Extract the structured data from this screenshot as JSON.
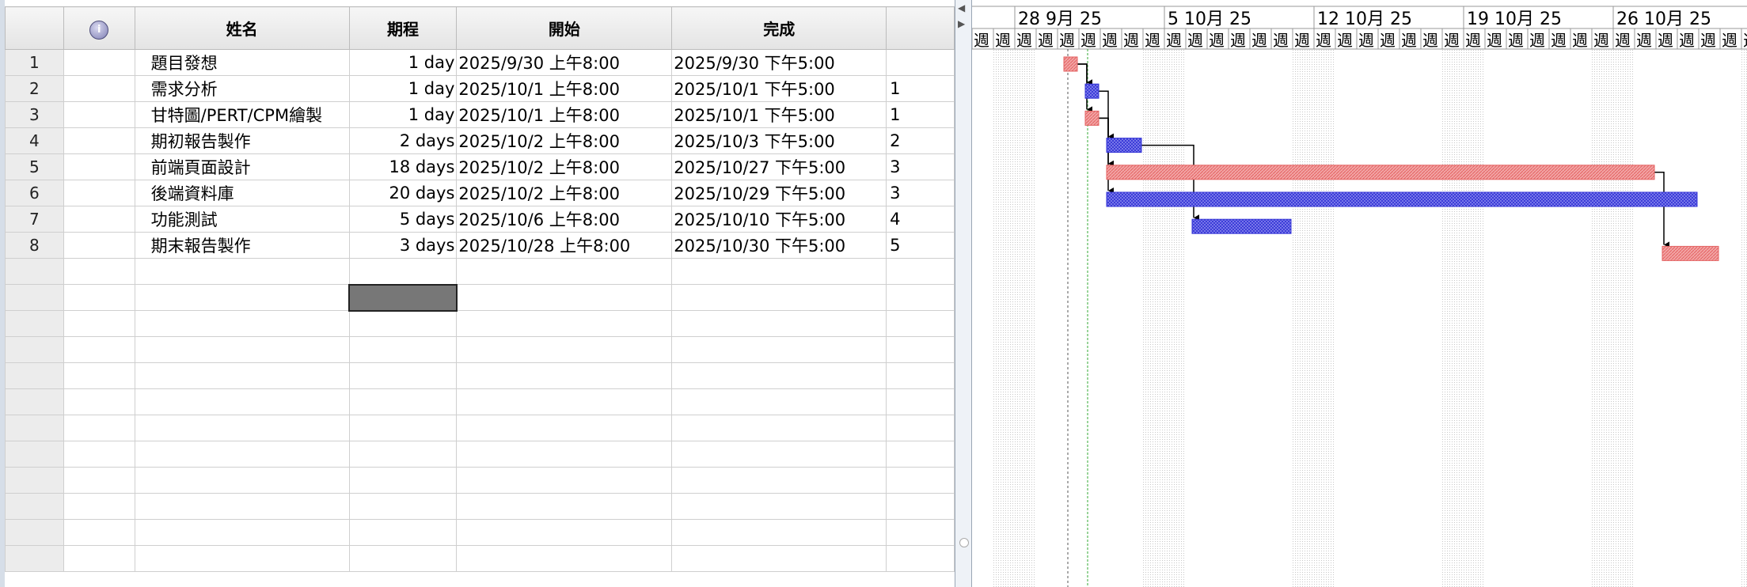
{
  "table": {
    "headers": {
      "indicator_icon": "information-icon",
      "name": "姓名",
      "duration": "期程",
      "start": "開始",
      "finish": "完成",
      "predecessors": ""
    },
    "rows": [
      {
        "id": "1",
        "name": "題目發想",
        "duration": "1 day",
        "start": "2025/9/30 上午8:00",
        "finish": "2025/9/30 下午5:00",
        "pred": ""
      },
      {
        "id": "2",
        "name": "需求分析",
        "duration": "1 day",
        "start": "2025/10/1 上午8:00",
        "finish": "2025/10/1 下午5:00",
        "pred": "1"
      },
      {
        "id": "3",
        "name": "甘特圖/PERT/CPM繪製",
        "duration": "1 day",
        "start": "2025/10/1 上午8:00",
        "finish": "2025/10/1 下午5:00",
        "pred": "1"
      },
      {
        "id": "4",
        "name": "期初報告製作",
        "duration": "2 days",
        "start": "2025/10/2 上午8:00",
        "finish": "2025/10/3 下午5:00",
        "pred": "2"
      },
      {
        "id": "5",
        "name": "前端頁面設計",
        "duration": "18 days",
        "start": "2025/10/2 上午8:00",
        "finish": "2025/10/27 下午5:00",
        "pred": "3"
      },
      {
        "id": "6",
        "name": "後端資料庫",
        "duration": "20 days",
        "start": "2025/10/2 上午8:00",
        "finish": "2025/10/29 下午5:00",
        "pred": "3"
      },
      {
        "id": "7",
        "name": "功能測試",
        "duration": "5 days",
        "start": "2025/10/6 上午8:00",
        "finish": "2025/10/10 下午5:00",
        "pred": "4"
      },
      {
        "id": "8",
        "name": "期末報告製作",
        "duration": "3 days",
        "start": "2025/10/28 上午8:00",
        "finish": "2025/10/30 下午5:00",
        "pred": "5"
      }
    ],
    "empty_row_count": 12
  },
  "splitter": {
    "collapse_left_icon": "triangle-left-icon",
    "collapse_right_icon": "triangle-right-icon"
  },
  "gantt": {
    "timeline_major": [
      {
        "label": "28 9月 25",
        "date": "2025-09-28"
      },
      {
        "label": "5 10月 25",
        "date": "2025-10-05"
      },
      {
        "label": "12 10月 25",
        "date": "2025-10-12"
      },
      {
        "label": "19 10月 25",
        "date": "2025-10-19"
      },
      {
        "label": "26 10月 25",
        "date": "2025-10-26"
      }
    ],
    "timeline_minor_label": "週",
    "today_marker_date": "2025-09-30",
    "status_line_date": "2025-10-01",
    "bars": [
      {
        "task": "1",
        "start": "2025-09-30",
        "finish": "2025-09-30",
        "color": "red"
      },
      {
        "task": "2",
        "start": "2025-10-01",
        "finish": "2025-10-01",
        "color": "blue"
      },
      {
        "task": "3",
        "start": "2025-10-01",
        "finish": "2025-10-01",
        "color": "red"
      },
      {
        "task": "4",
        "start": "2025-10-02",
        "finish": "2025-10-03",
        "color": "blue"
      },
      {
        "task": "5",
        "start": "2025-10-02",
        "finish": "2025-10-27",
        "color": "red"
      },
      {
        "task": "6",
        "start": "2025-10-02",
        "finish": "2025-10-29",
        "color": "blue"
      },
      {
        "task": "7",
        "start": "2025-10-06",
        "finish": "2025-10-10",
        "color": "blue"
      },
      {
        "task": "8",
        "start": "2025-10-28",
        "finish": "2025-10-30",
        "color": "red"
      }
    ],
    "dependencies": [
      {
        "from": "1",
        "to": "2"
      },
      {
        "from": "1",
        "to": "3"
      },
      {
        "from": "2",
        "to": "4"
      },
      {
        "from": "3",
        "to": "5"
      },
      {
        "from": "3",
        "to": "6"
      },
      {
        "from": "4",
        "to": "7"
      },
      {
        "from": "5",
        "to": "8"
      }
    ],
    "colors": {
      "critical": "#e46262",
      "critical_fill": "#f2a5a5",
      "normal": "#3535d6",
      "normal_fill": "#8f8ff0",
      "weekend_shade": "#eaeaea",
      "today_line": "#555555",
      "status_line": "#33aa33"
    }
  }
}
